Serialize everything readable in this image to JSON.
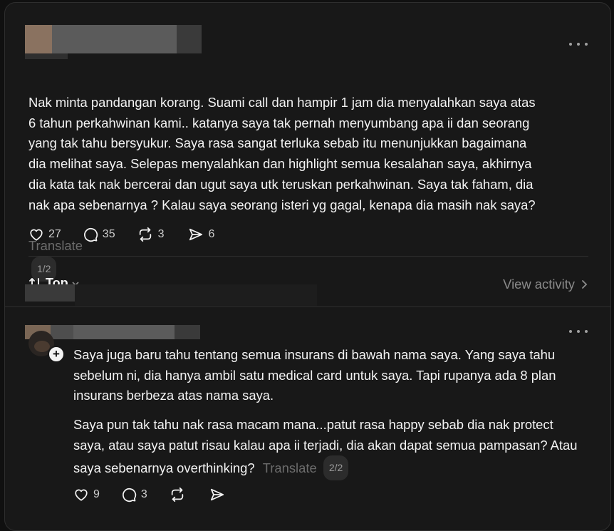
{
  "post": {
    "text": "Nak minta pandangan korang. Suami call dan hampir 1 jam dia menyalahkan saya atas\n6 tahun perkahwinan kami.. katanya saya tak pernah menyumbang apa ii dan seorang\nyang tak tahu bersyukur. Saya rasa sangat terluka sebab itu menunjukkan bagaimana\ndia melihat saya. Selepas menyalahkan dan highlight semua kesalahan saya, akhirnya\ndia kata tak nak bercerai dan ugut saya utk teruskan perkahwinan. Saya tak faham, dia\nnak apa sebenarnya ? Kalau saya seorang isteri yg gagal, kenapa dia masih nak saya?",
    "translate_label": "Translate",
    "page": "1/2",
    "likes": "27",
    "replies": "35",
    "reposts": "3",
    "shares": "6"
  },
  "sort": {
    "label": "Top"
  },
  "view_activity": {
    "label": "View activity"
  },
  "reply": {
    "paragraph1": "Saya juga baru tahu tentang semua insurans di bawah nama saya. Yang saya tahu sebelum ni, dia hanya ambil satu medical card untuk saya. Tapi rupanya ada 8 plan insurans berbeza atas nama saya.",
    "paragraph2": "Saya pun tak tahu nak rasa macam mana...patut rasa happy sebab dia nak protect saya, atau saya patut risau kalau apa ii terjadi, dia akan dapat semua pampasan? Atau saya sebenarnya overthinking?",
    "translate_label": "Translate",
    "page": "2/2",
    "likes": "9",
    "replies": "3"
  },
  "icons": {
    "more": "more-horizontal-icon",
    "like": "heart-icon",
    "reply": "comment-icon",
    "repost": "repost-icon",
    "share": "send-icon",
    "sort": "sort-arrows-icon",
    "chevron": "chevron-right-icon",
    "follow": "plus-icon"
  },
  "colors": {
    "background": "#101010",
    "card": "#181818",
    "text": "#f3f3f3",
    "muted": "#6c6c6c"
  }
}
